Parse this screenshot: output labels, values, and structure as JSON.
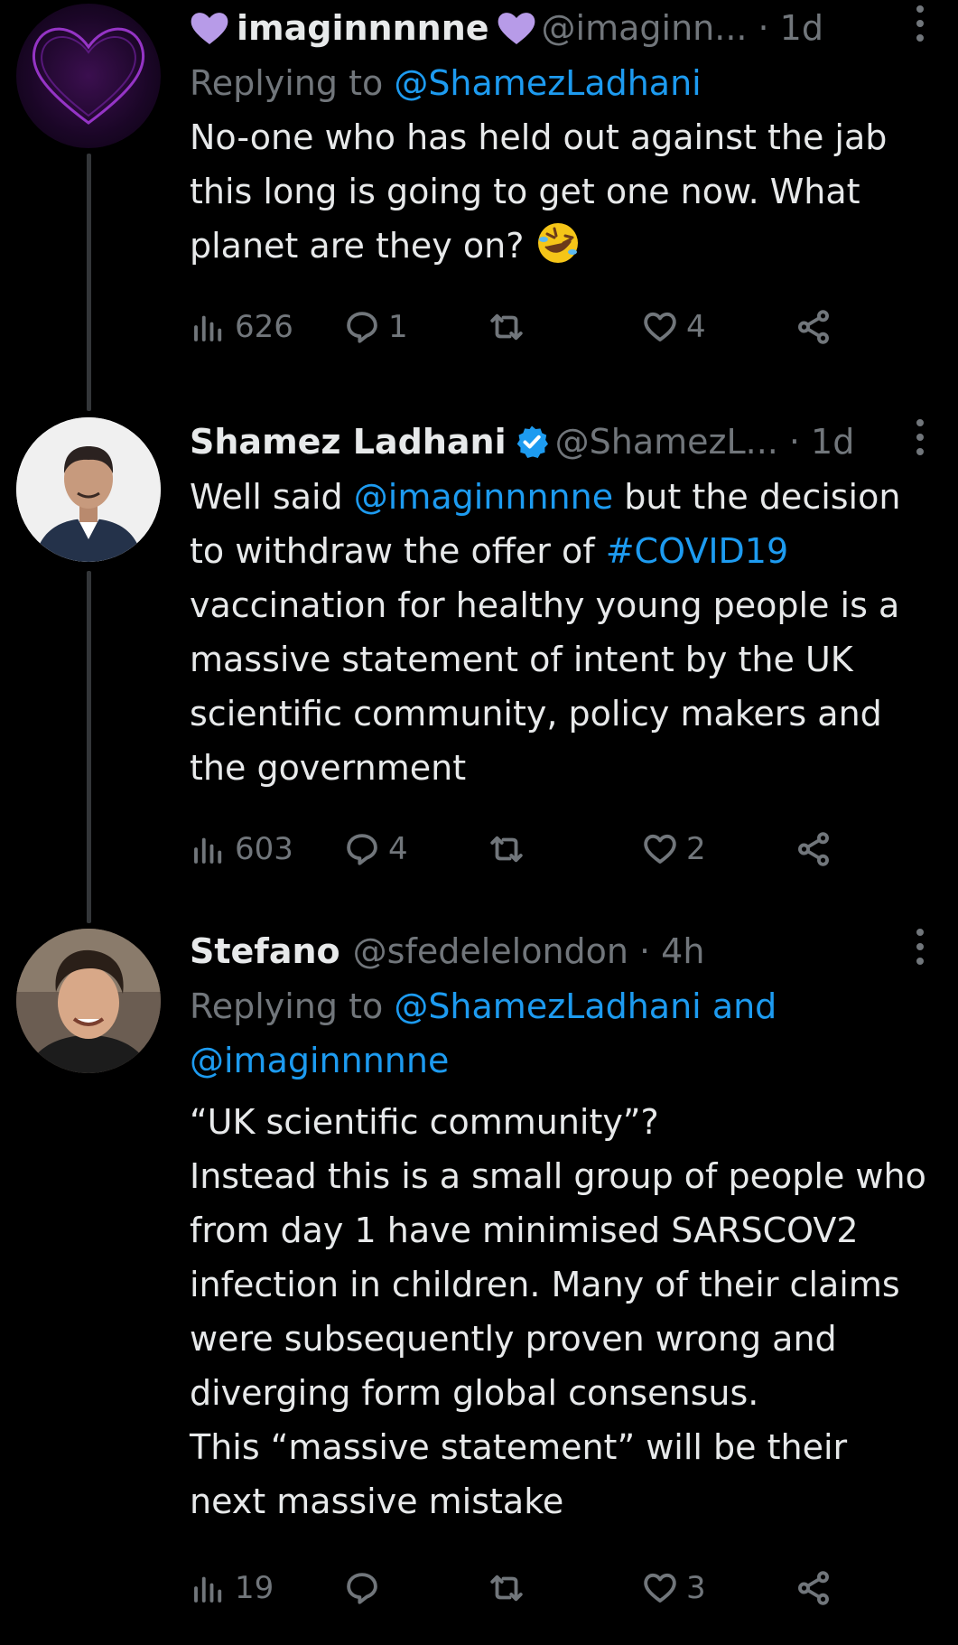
{
  "tweets": [
    {
      "name": "imaginnnnne",
      "handle": "@imaginn...",
      "time": "· 1d",
      "replying_prefix": "Replying to ",
      "replying_to": "@ShamezLadhani",
      "text_1": "No-one who has held out against the jab this long is going to get one now. What planet are they on? ",
      "emoji": "rolling-on-floor-laughing",
      "views": "626",
      "replies": "1",
      "retweets": "",
      "likes": "4"
    },
    {
      "name": "Shamez Ladhani",
      "handle": "@ShamezL...",
      "time": "· 1d",
      "text_pre": "Well said ",
      "text_mention": "@imaginnnnne",
      "text_mid": " but the decision to withdraw the offer of ",
      "text_hashtag": "#COVID19",
      "text_post": " vaccination for healthy young people is a massive statement of intent by the UK scientific community, policy makers and the government",
      "views": "603",
      "replies": "4",
      "retweets": "",
      "likes": "2"
    },
    {
      "name": "Stefano",
      "handle": "@sfedelelondon",
      "time": "· 4h",
      "replying_prefix": "Replying to ",
      "replying_to": "@ShamezLadhani and",
      "replying_to_2": "@imaginnnnne",
      "text_lines": [
        "“UK scientific community”?",
        "Instead this is a small group of people who from day 1 have minimised SARSCOV2 infection in children. Many of their claims were subsequently proven wrong and diverging form global consensus.",
        "This “massive statement” will be their next massive mistake"
      ],
      "views": "19",
      "replies": "",
      "retweets": "",
      "likes": "3"
    }
  ],
  "colors": {
    "background": "#000000",
    "text": "#e7e9ea",
    "secondary": "#71767b",
    "link": "#1d9bf0",
    "heart_emoji": "#b79be8"
  }
}
